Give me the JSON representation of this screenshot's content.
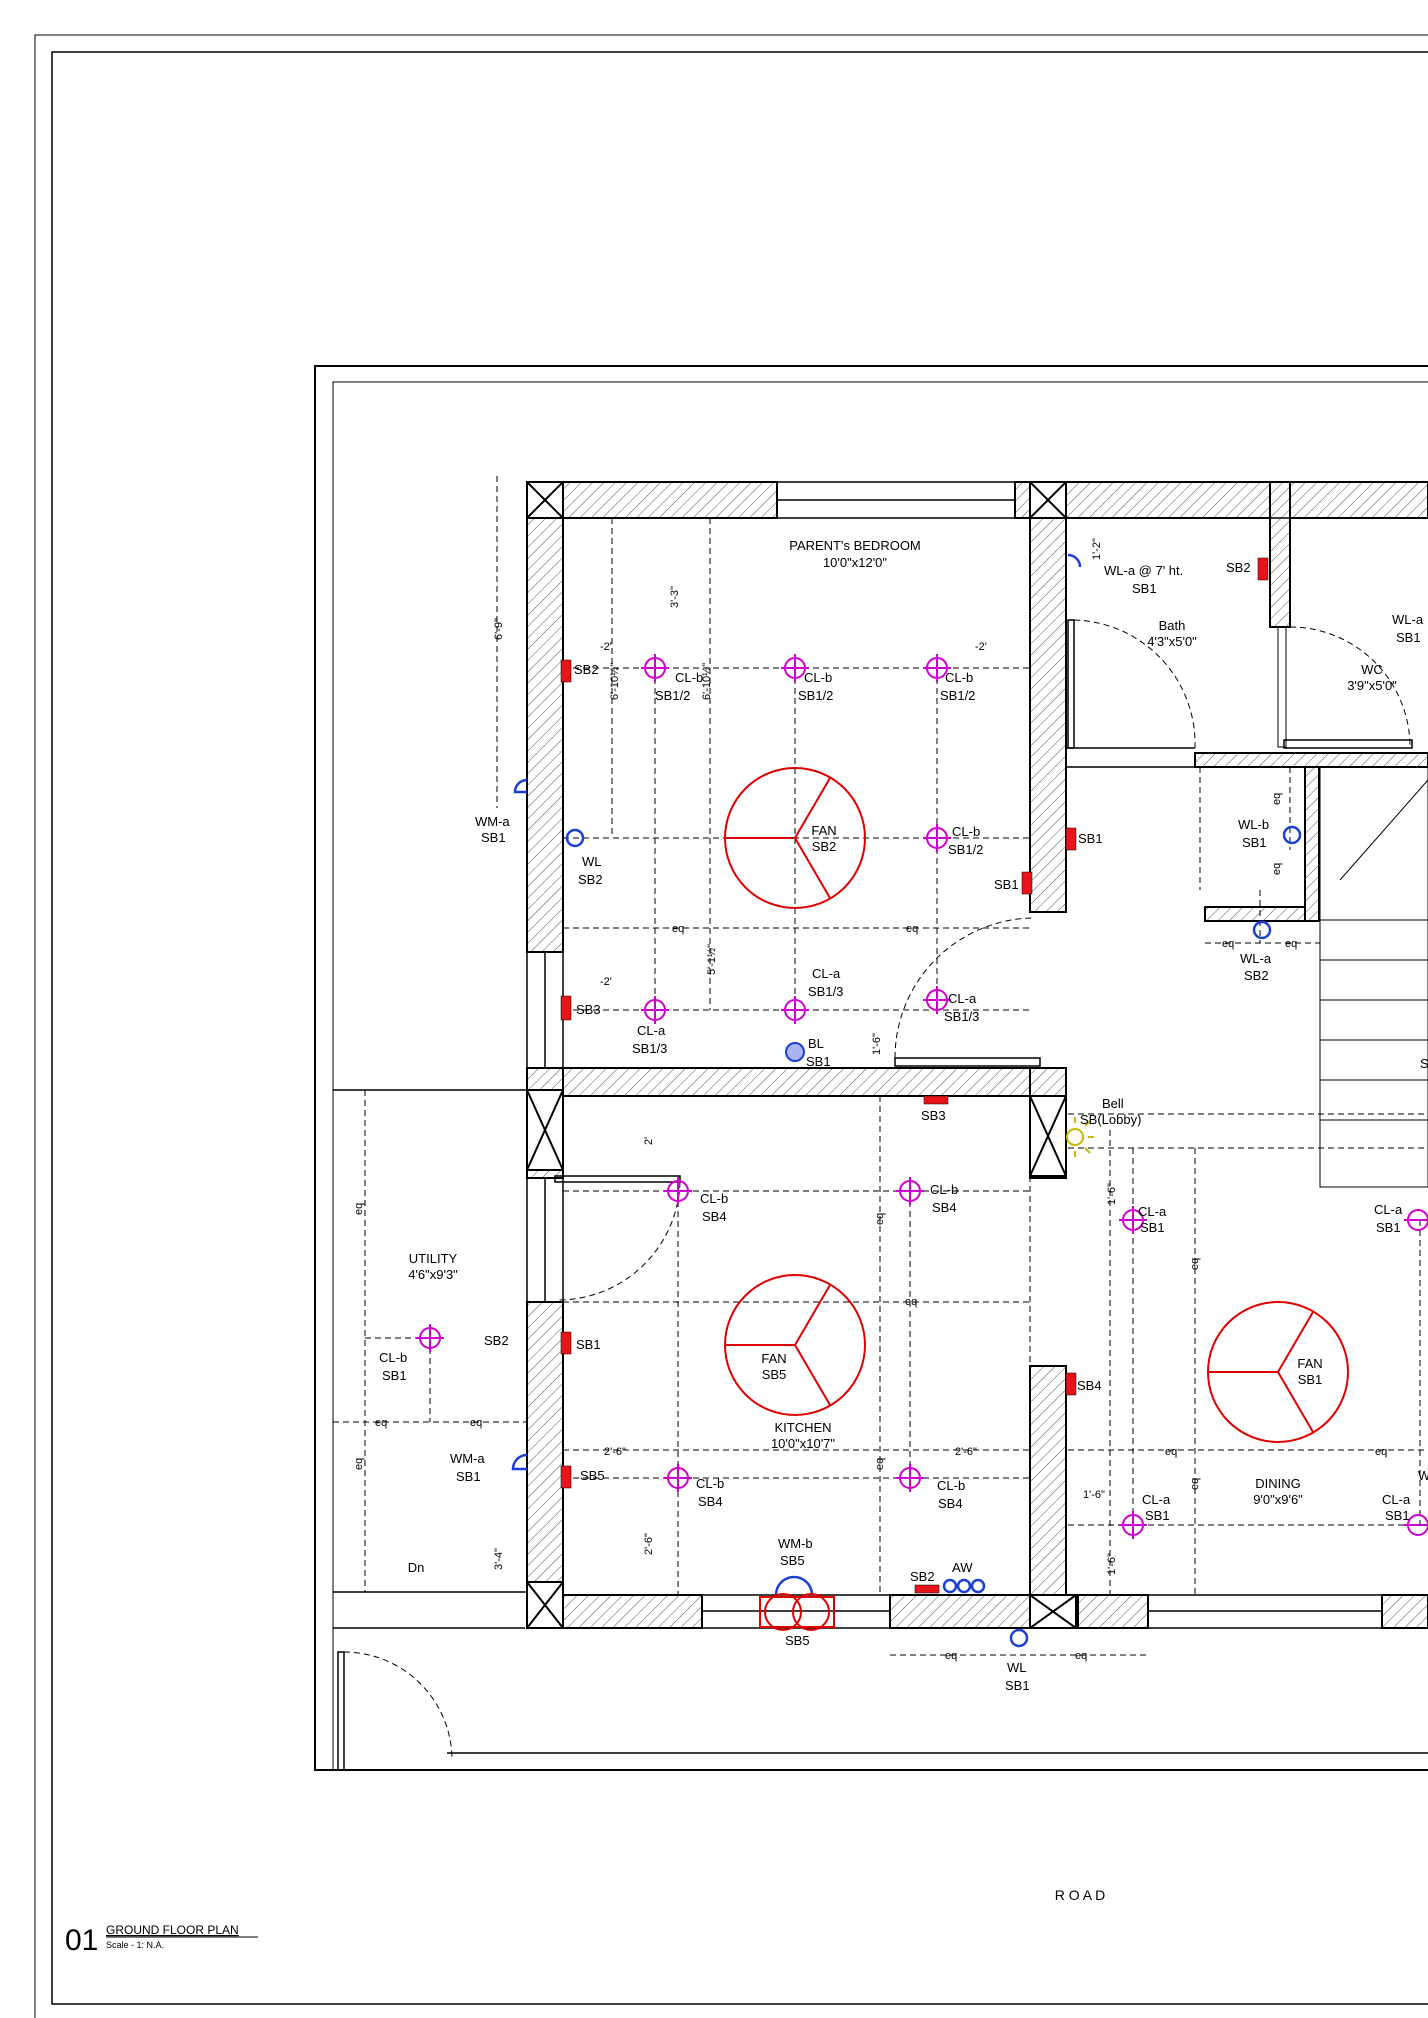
{
  "drawing": {
    "number": "01",
    "title": "GROUND FLOOR PLAN",
    "scale": "Scale - 1: N.A.",
    "road": "R O A D"
  },
  "rooms": {
    "parents_bedroom": {
      "name": "PARENT's BEDROOM",
      "size": "10'0\"x12'0\""
    },
    "bath": {
      "name": "Bath",
      "size": "4'3\"x5'0\""
    },
    "wc": {
      "name": "WC",
      "size": "3'9\"x5'0\""
    },
    "utility": {
      "name": "UTILITY",
      "size": "4'6\"x9'3\""
    },
    "kitchen": {
      "name": "KITCHEN",
      "size": "10'0\"x10'7\""
    },
    "dining": {
      "name": "DINING",
      "size": "9'0\"x9'6\""
    },
    "dn": "Dn"
  },
  "fixtures": {
    "fan_sb2": {
      "name": "FAN",
      "circuit": "SB2"
    },
    "fan_sb5": {
      "name": "FAN",
      "circuit": "SB5"
    },
    "fan_sb1": {
      "name": "FAN",
      "circuit": "SB1"
    },
    "clb": "CL-b",
    "cla": "CL-a",
    "sb12": "SB1/2",
    "sb13": "SB1/3",
    "sb1": "SB1",
    "sb2": "SB2",
    "sb3": "SB3",
    "sb4": "SB4",
    "sb5": "SB5",
    "sbx": "SB",
    "wl": "WL",
    "wla7": "WL-a @ 7' ht.",
    "wla": "WL-a",
    "wlb": "WL-b",
    "wma": "WM-a",
    "wmb": "WM-b",
    "bl": "BL",
    "bell": "Bell",
    "sb_lobby": "SB(Lobby)",
    "aw": "AW",
    "w": "W"
  },
  "dims": {
    "d69": "6'-9\"",
    "d33": "3'-3\"",
    "d2": "2'",
    "d2b": "-2'",
    "d6102": "6'-10½\"",
    "d12": "1'-2\"",
    "deq": "eq",
    "d5112": "5'-1½\"",
    "d16": "1'-6\"",
    "d26": "2'-6\"",
    "d34": "3'-4\""
  },
  "colors": {
    "fan_red": "#e00000",
    "light_magenta": "#d000d0",
    "wall_light_blue": "#1a3fd6",
    "switchboard_red": "#e8141a",
    "bell_yellow": "#c9b800"
  }
}
